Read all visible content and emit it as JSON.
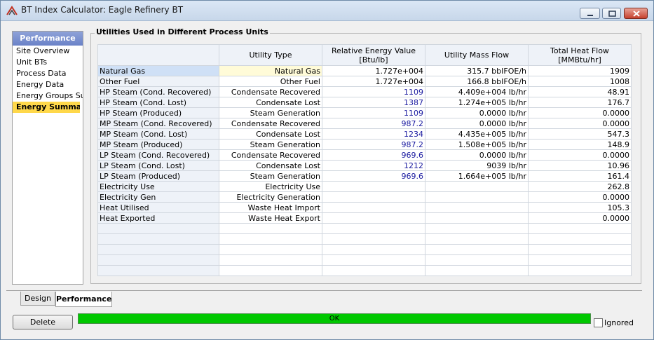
{
  "window": {
    "title": "BT Index Calculator: Eagle Refinery BT"
  },
  "nav": {
    "header": "Performance",
    "items": [
      {
        "label": "Site Overview"
      },
      {
        "label": "Unit BTs"
      },
      {
        "label": "Process Data"
      },
      {
        "label": "Energy Data"
      },
      {
        "label": "Energy Groups Sum"
      },
      {
        "label": "Energy Summary"
      }
    ],
    "selected": "Energy Summary"
  },
  "group": {
    "label": "Utilities Used in Different Process Units"
  },
  "table": {
    "headers": {
      "utility_type": "Utility Type",
      "rel_energy_l1": "Relative Energy Value",
      "rel_energy_l2": "[Btu/lb]",
      "mass_flow": "Utility Mass Flow",
      "heat_flow_l1": "Total Heat Flow",
      "heat_flow_l2": "[MMBtu/hr]"
    },
    "rows": [
      {
        "name": "Natural Gas",
        "type": "Natural Gas",
        "rel": "1.727e+004",
        "mass": "315.7 bbIFOE/h",
        "heat": "1909"
      },
      {
        "name": "Other Fuel",
        "type": "Other Fuel",
        "rel": "1.727e+004",
        "mass": "166.8 bbIFOE/h",
        "heat": "1008"
      },
      {
        "name": "HP Steam (Cond. Recovered)",
        "type": "Condensate Recovered",
        "rel": "1109",
        "mass": "4.409e+004 lb/hr",
        "heat": "48.91"
      },
      {
        "name": "HP Steam (Cond. Lost)",
        "type": "Condensate Lost",
        "rel": "1387",
        "mass": "1.274e+005 lb/hr",
        "heat": "176.7"
      },
      {
        "name": "HP Steam (Produced)",
        "type": "Steam Generation",
        "rel": "1109",
        "mass": "0.0000 lb/hr",
        "heat": "0.0000"
      },
      {
        "name": "MP Steam (Cond. Recovered)",
        "type": "Condensate Recovered",
        "rel": "987.2",
        "mass": "0.0000 lb/hr",
        "heat": "0.0000"
      },
      {
        "name": "MP Steam (Cond. Lost)",
        "type": "Condensate Lost",
        "rel": "1234",
        "mass": "4.435e+005 lb/hr",
        "heat": "547.3"
      },
      {
        "name": "MP Steam (Produced)",
        "type": "Steam Generation",
        "rel": "987.2",
        "mass": "1.508e+005 lb/hr",
        "heat": "148.9"
      },
      {
        "name": "LP Steam (Cond. Recovered)",
        "type": "Condensate Recovered",
        "rel": "969.6",
        "mass": "0.0000 lb/hr",
        "heat": "0.0000"
      },
      {
        "name": "LP Steam (Cond. Lost)",
        "type": "Condensate Lost",
        "rel": "1212",
        "mass": "9039 lb/hr",
        "heat": "10.96"
      },
      {
        "name": "LP Steam (Produced)",
        "type": "Steam Generation",
        "rel": "969.6",
        "mass": "1.664e+005 lb/hr",
        "heat": "161.4"
      },
      {
        "name": "Electricity Use",
        "type": "Electricity Use",
        "rel": "",
        "mass": "",
        "heat": "262.8"
      },
      {
        "name": "Electricity Gen",
        "type": "Electricity Generation",
        "rel": "",
        "mass": "",
        "heat": "0.0000"
      },
      {
        "name": "Heat Utilised",
        "type": "Waste Heat Import",
        "rel": "",
        "mass": "",
        "heat": "105.3"
      },
      {
        "name": "Heat Exported",
        "type": "Waste Heat Export",
        "rel": "",
        "mass": "",
        "heat": "0.0000"
      }
    ],
    "empty_rows": 5
  },
  "tabs": [
    {
      "label": "Design"
    },
    {
      "label": "Performance"
    }
  ],
  "footer": {
    "delete_label": "Delete",
    "status_text": "OK",
    "ignored_label": "Ignored",
    "ignored_checked": false
  },
  "colors": {
    "status_ok": "#00c800",
    "nav_selected": "#ffd84a",
    "blue_value": "#1a1aa0"
  }
}
